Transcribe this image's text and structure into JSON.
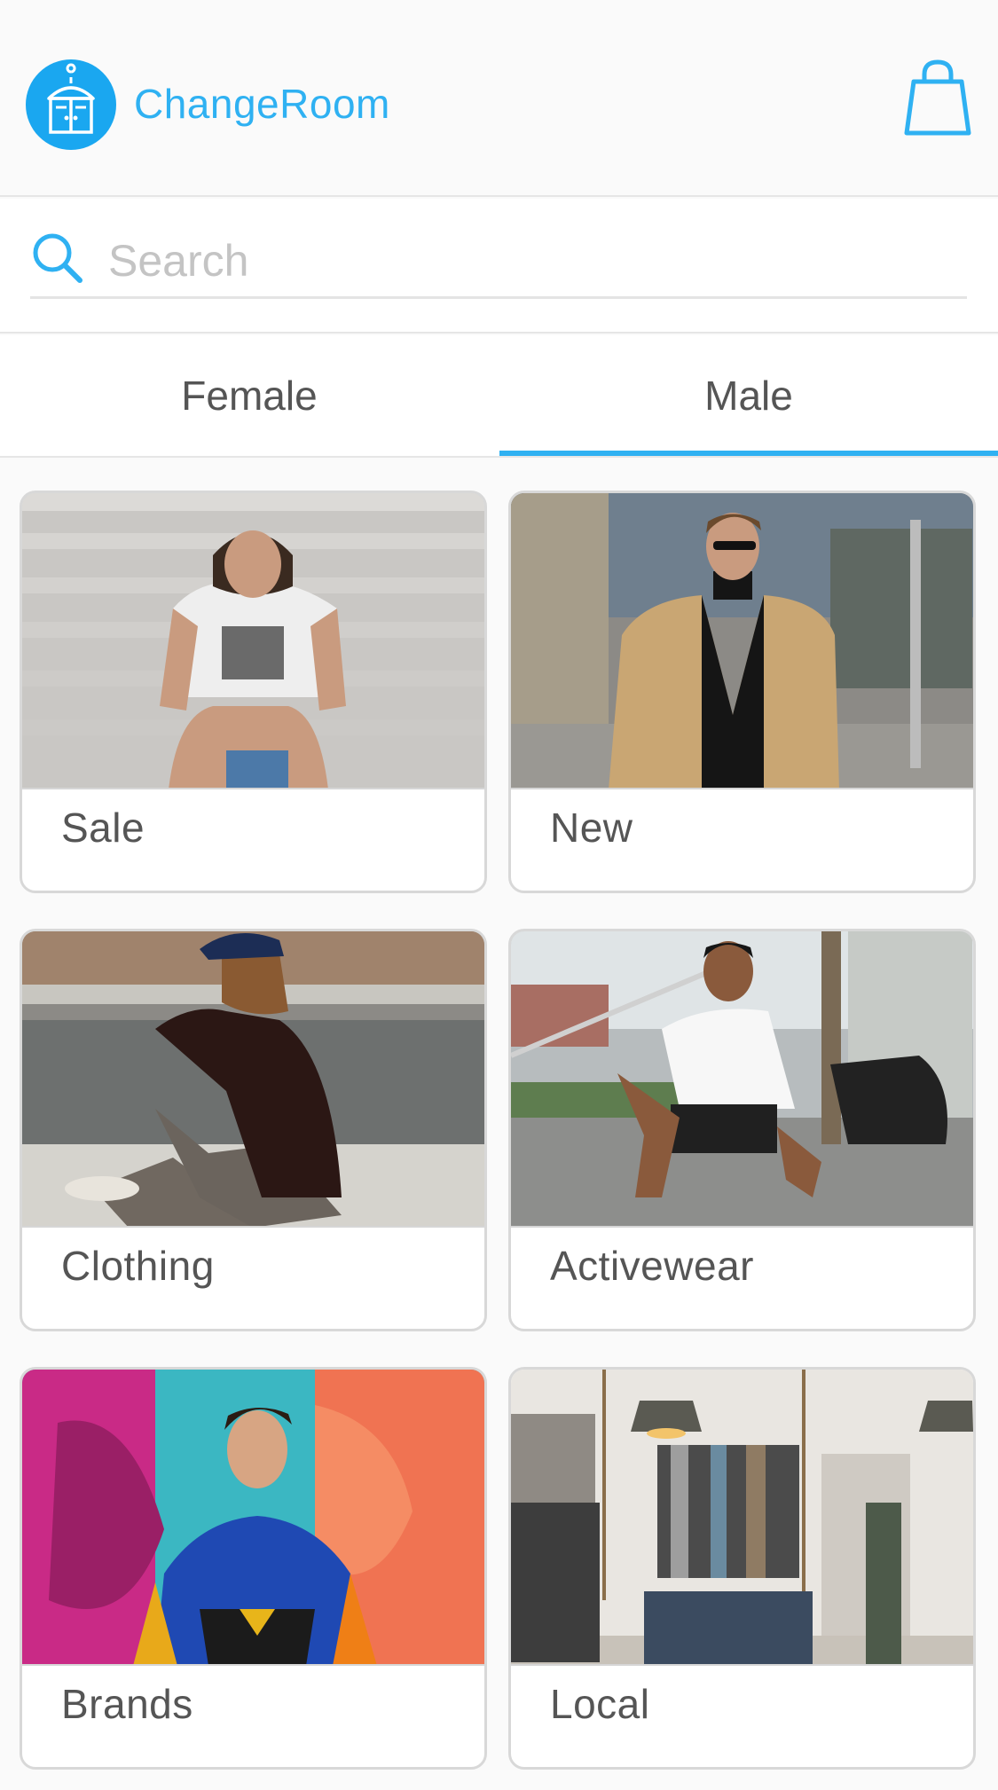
{
  "header": {
    "app_title": "ChangeRoom",
    "logo_icon": "wardrobe-icon",
    "cart_icon": "shopping-bag-icon"
  },
  "search": {
    "placeholder": "Search",
    "value": "",
    "icon": "search-icon"
  },
  "tabs": [
    {
      "label": "Female",
      "selected": false
    },
    {
      "label": "Male",
      "selected": true
    }
  ],
  "categories": [
    {
      "label": "Sale"
    },
    {
      "label": "New"
    },
    {
      "label": "Clothing"
    },
    {
      "label": "Activewear"
    },
    {
      "label": "Brands"
    },
    {
      "label": "Local"
    }
  ],
  "colors": {
    "accent": "#2fb1f2",
    "logo_bg": "#1aa7f0",
    "background": "#fafafa",
    "text": "#555555"
  }
}
